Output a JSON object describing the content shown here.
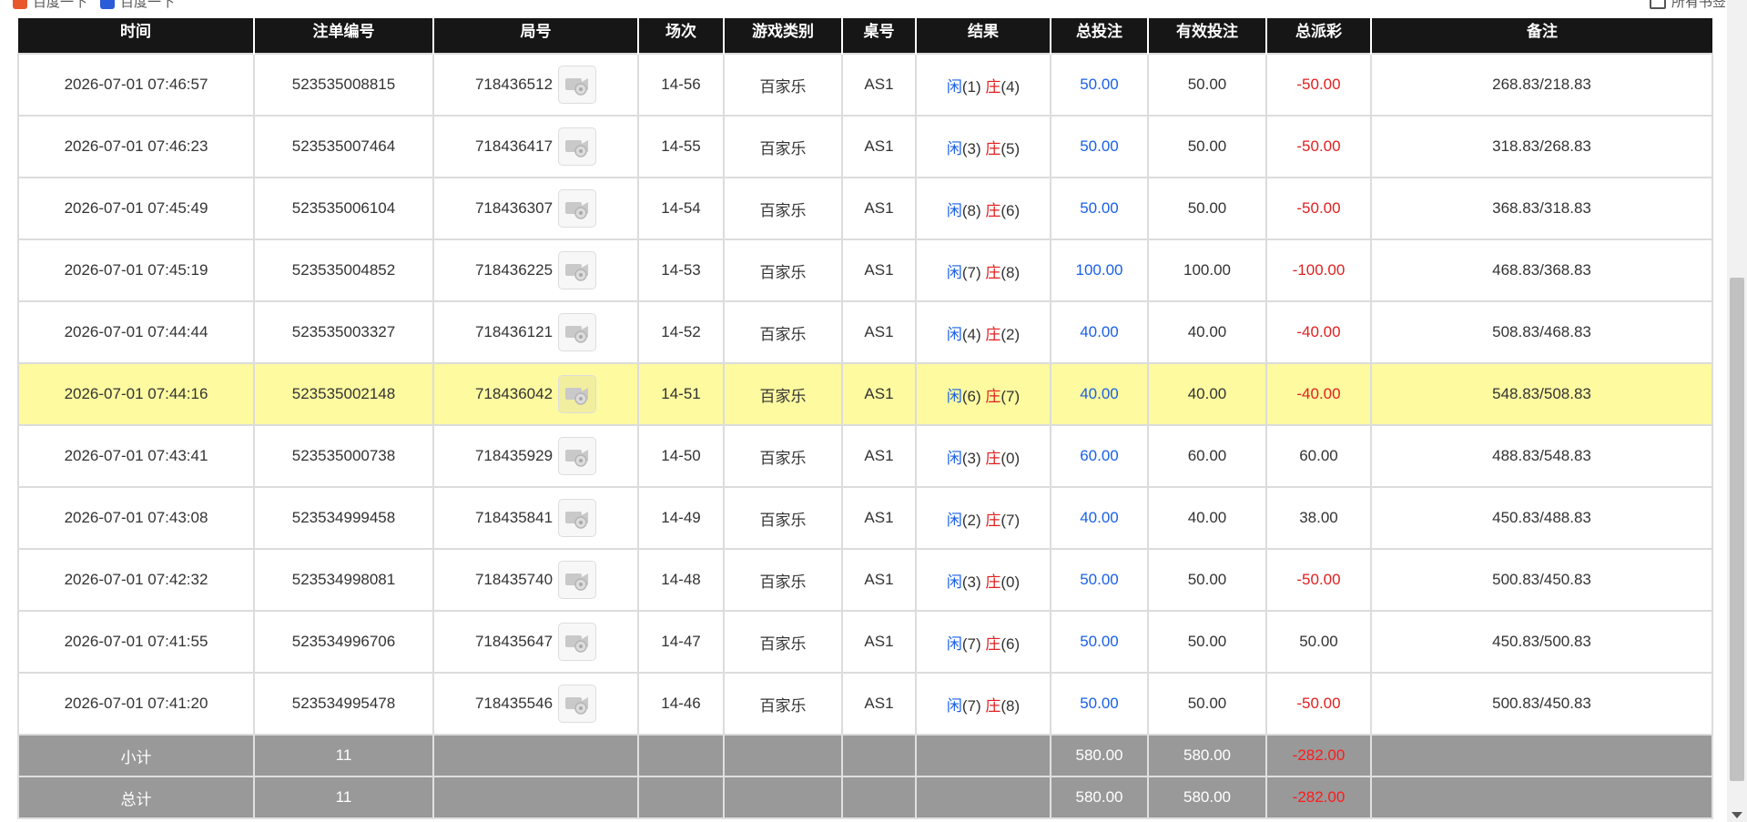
{
  "bookmarks": {
    "item1": "百度一下",
    "item2": "百度一下",
    "right": "所有书签"
  },
  "headers": [
    "时间",
    "注单编号",
    "局号",
    "场次",
    "游戏类别",
    "桌号",
    "结果",
    "总投注",
    "有效投注",
    "总派彩",
    "备注"
  ],
  "result_labels": {
    "player": "闲",
    "banker": "庄"
  },
  "rows": [
    {
      "time": "2026-07-01 07:46:57",
      "bet_id": "523535008815",
      "round": "718436512",
      "shoe": "14-56",
      "game": "百家乐",
      "table": "AS1",
      "p": "(1)",
      "b": "(4)",
      "total": "50.00",
      "valid": "50.00",
      "payout": "-50.00",
      "payout_neg": true,
      "note": "268.83/218.83"
    },
    {
      "time": "2026-07-01 07:46:23",
      "bet_id": "523535007464",
      "round": "718436417",
      "shoe": "14-55",
      "game": "百家乐",
      "table": "AS1",
      "p": "(3)",
      "b": "(5)",
      "total": "50.00",
      "valid": "50.00",
      "payout": "-50.00",
      "payout_neg": true,
      "note": "318.83/268.83"
    },
    {
      "time": "2026-07-01 07:45:49",
      "bet_id": "523535006104",
      "round": "718436307",
      "shoe": "14-54",
      "game": "百家乐",
      "table": "AS1",
      "p": "(8)",
      "b": "(6)",
      "total": "50.00",
      "valid": "50.00",
      "payout": "-50.00",
      "payout_neg": true,
      "note": "368.83/318.83"
    },
    {
      "time": "2026-07-01 07:45:19",
      "bet_id": "523535004852",
      "round": "718436225",
      "shoe": "14-53",
      "game": "百家乐",
      "table": "AS1",
      "p": "(7)",
      "b": "(8)",
      "total": "100.00",
      "valid": "100.00",
      "payout": "-100.00",
      "payout_neg": true,
      "note": "468.83/368.83"
    },
    {
      "time": "2026-07-01 07:44:44",
      "bet_id": "523535003327",
      "round": "718436121",
      "shoe": "14-52",
      "game": "百家乐",
      "table": "AS1",
      "p": "(4)",
      "b": "(2)",
      "total": "40.00",
      "valid": "40.00",
      "payout": "-40.00",
      "payout_neg": true,
      "note": "508.83/468.83"
    },
    {
      "time": "2026-07-01 07:44:16",
      "bet_id": "523535002148",
      "round": "718436042",
      "shoe": "14-51",
      "game": "百家乐",
      "table": "AS1",
      "p": "(6)",
      "b": "(7)",
      "total": "40.00",
      "valid": "40.00",
      "payout": "-40.00",
      "payout_neg": true,
      "note": "548.83/508.83",
      "highlight": true
    },
    {
      "time": "2026-07-01 07:43:41",
      "bet_id": "523535000738",
      "round": "718435929",
      "shoe": "14-50",
      "game": "百家乐",
      "table": "AS1",
      "p": "(3)",
      "b": "(0)",
      "total": "60.00",
      "valid": "60.00",
      "payout": "60.00",
      "payout_neg": false,
      "note": "488.83/548.83"
    },
    {
      "time": "2026-07-01 07:43:08",
      "bet_id": "523534999458",
      "round": "718435841",
      "shoe": "14-49",
      "game": "百家乐",
      "table": "AS1",
      "p": "(2)",
      "b": "(7)",
      "total": "40.00",
      "valid": "40.00",
      "payout": "38.00",
      "payout_neg": false,
      "note": "450.83/488.83"
    },
    {
      "time": "2026-07-01 07:42:32",
      "bet_id": "523534998081",
      "round": "718435740",
      "shoe": "14-48",
      "game": "百家乐",
      "table": "AS1",
      "p": "(3)",
      "b": "(0)",
      "total": "50.00",
      "valid": "50.00",
      "payout": "-50.00",
      "payout_neg": true,
      "note": "500.83/450.83"
    },
    {
      "time": "2026-07-01 07:41:55",
      "bet_id": "523534996706",
      "round": "718435647",
      "shoe": "14-47",
      "game": "百家乐",
      "table": "AS1",
      "p": "(7)",
      "b": "(6)",
      "total": "50.00",
      "valid": "50.00",
      "payout": "50.00",
      "payout_neg": false,
      "note": "450.83/500.83"
    },
    {
      "time": "2026-07-01 07:41:20",
      "bet_id": "523534995478",
      "round": "718435546",
      "shoe": "14-46",
      "game": "百家乐",
      "table": "AS1",
      "p": "(7)",
      "b": "(8)",
      "total": "50.00",
      "valid": "50.00",
      "payout": "-50.00",
      "payout_neg": true,
      "note": "500.83/450.83"
    }
  ],
  "footer": [
    {
      "label": "小计",
      "count": "11",
      "total": "580.00",
      "valid": "580.00",
      "payout": "-282.00"
    },
    {
      "label": "总计",
      "count": "11",
      "total": "580.00",
      "valid": "580.00",
      "payout": "-282.00"
    }
  ]
}
